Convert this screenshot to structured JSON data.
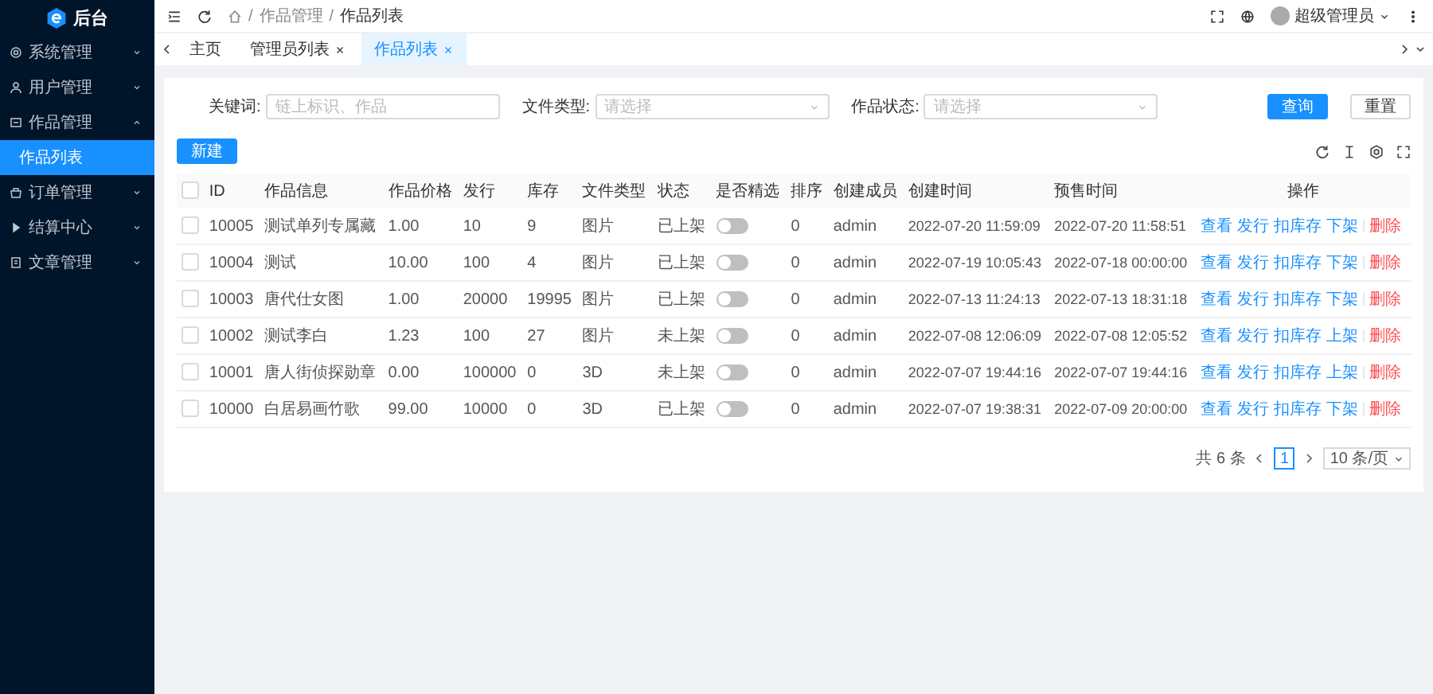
{
  "brand": {
    "title": "后台"
  },
  "sidebar": {
    "items": [
      {
        "label": "系统管理",
        "expanded": false
      },
      {
        "label": "用户管理",
        "expanded": false
      },
      {
        "label": "作品管理",
        "expanded": true,
        "children": [
          {
            "label": "作品列表",
            "selected": true
          }
        ]
      },
      {
        "label": "订单管理",
        "expanded": false
      },
      {
        "label": "结算中心",
        "expanded": false
      },
      {
        "label": "文章管理",
        "expanded": false
      }
    ]
  },
  "header": {
    "breadcrumb_separator": "/",
    "breadcrumb": [
      "作品管理",
      "作品列表"
    ],
    "user": "超级管理员"
  },
  "tabs": [
    {
      "label": "主页",
      "closable": false,
      "selected": false
    },
    {
      "label": "管理员列表",
      "closable": true,
      "selected": false
    },
    {
      "label": "作品列表",
      "closable": true,
      "selected": true
    }
  ],
  "filters": [
    {
      "label": "关键词:",
      "kind": "input",
      "placeholder": "链上标识、作品"
    },
    {
      "label": "文件类型:",
      "kind": "select",
      "placeholder": "请选择"
    },
    {
      "label": "作品状态:",
      "kind": "select",
      "placeholder": "请选择"
    }
  ],
  "query_button": "查询",
  "reset_button": "重置",
  "new_button": "新建",
  "table": {
    "select_all_checked": false,
    "columns": [
      "ID",
      "作品信息",
      "作品价格",
      "发行",
      "库存",
      "文件类型",
      "状态",
      "是否精选",
      "排序",
      "创建成员",
      "创建时间",
      "预售时间",
      "操作"
    ],
    "rows": [
      {
        "checked": false,
        "id": "10005",
        "info": "测试单列专属藏",
        "price": "1.00",
        "issue": "10",
        "stock": "9",
        "type": "图片",
        "status": "已上架",
        "featured": false,
        "sort": "0",
        "creator": "admin",
        "created": "2022-07-20 11:59:09",
        "presale": "2022-07-20 11:58:51",
        "actions": [
          {
            "label": "查看",
            "kind": "link"
          },
          {
            "label": "发行",
            "kind": "link"
          },
          {
            "label": "扣库存",
            "kind": "link"
          },
          {
            "label": "下架",
            "kind": "link"
          },
          {
            "label": "删除",
            "kind": "danger"
          }
        ]
      },
      {
        "checked": false,
        "id": "10004",
        "info": "测试",
        "price": "10.00",
        "issue": "100",
        "stock": "4",
        "type": "图片",
        "status": "已上架",
        "featured": false,
        "sort": "0",
        "creator": "admin",
        "created": "2022-07-19 10:05:43",
        "presale": "2022-07-18 00:00:00",
        "actions": [
          {
            "label": "查看",
            "kind": "link"
          },
          {
            "label": "发行",
            "kind": "link"
          },
          {
            "label": "扣库存",
            "kind": "link"
          },
          {
            "label": "下架",
            "kind": "link"
          },
          {
            "label": "删除",
            "kind": "danger"
          }
        ]
      },
      {
        "checked": false,
        "id": "10003",
        "info": "唐代仕女图",
        "price": "1.00",
        "issue": "20000",
        "stock": "19995",
        "type": "图片",
        "status": "已上架",
        "featured": false,
        "sort": "0",
        "creator": "admin",
        "created": "2022-07-13 11:24:13",
        "presale": "2022-07-13 18:31:18",
        "actions": [
          {
            "label": "查看",
            "kind": "link"
          },
          {
            "label": "发行",
            "kind": "link"
          },
          {
            "label": "扣库存",
            "kind": "link"
          },
          {
            "label": "下架",
            "kind": "link"
          },
          {
            "label": "删除",
            "kind": "danger"
          }
        ]
      },
      {
        "checked": false,
        "id": "10002",
        "info": "测试李白",
        "price": "1.23",
        "issue": "100",
        "stock": "27",
        "type": "图片",
        "status": "未上架",
        "featured": false,
        "sort": "0",
        "creator": "admin",
        "created": "2022-07-08 12:06:09",
        "presale": "2022-07-08 12:05:52",
        "actions": [
          {
            "label": "查看",
            "kind": "link"
          },
          {
            "label": "发行",
            "kind": "link"
          },
          {
            "label": "扣库存",
            "kind": "link"
          },
          {
            "label": "上架",
            "kind": "link"
          },
          {
            "label": "删除",
            "kind": "danger"
          }
        ]
      },
      {
        "checked": false,
        "id": "10001",
        "info": "唐人街侦探勋章",
        "price": "0.00",
        "issue": "100000",
        "stock": "0",
        "type": "3D",
        "status": "未上架",
        "featured": false,
        "sort": "0",
        "creator": "admin",
        "created": "2022-07-07 19:44:16",
        "presale": "2022-07-07 19:44:16",
        "actions": [
          {
            "label": "查看",
            "kind": "link"
          },
          {
            "label": "发行",
            "kind": "link"
          },
          {
            "label": "扣库存",
            "kind": "link"
          },
          {
            "label": "上架",
            "kind": "link"
          },
          {
            "label": "删除",
            "kind": "danger"
          }
        ]
      },
      {
        "checked": false,
        "id": "10000",
        "info": "白居易画竹歌",
        "price": "99.00",
        "issue": "10000",
        "stock": "0",
        "type": "3D",
        "status": "已上架",
        "featured": false,
        "sort": "0",
        "creator": "admin",
        "created": "2022-07-07 19:38:31",
        "presale": "2022-07-09 20:00:00",
        "actions": [
          {
            "label": "查看",
            "kind": "link"
          },
          {
            "label": "发行",
            "kind": "link"
          },
          {
            "label": "扣库存",
            "kind": "link"
          },
          {
            "label": "下架",
            "kind": "link"
          },
          {
            "label": "删除",
            "kind": "danger"
          }
        ]
      }
    ]
  },
  "pagination": {
    "total": "共 6 条",
    "pages": [
      {
        "label": "1",
        "selected": true
      }
    ],
    "page_size": "10 条/页"
  }
}
